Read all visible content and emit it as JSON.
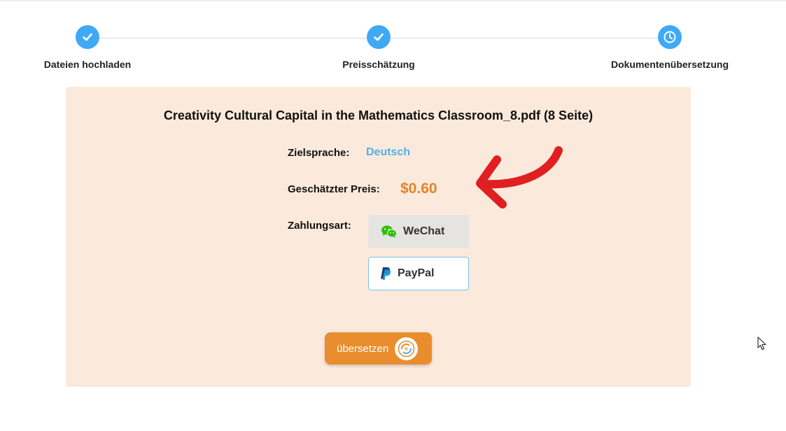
{
  "steps": [
    {
      "label": "Dateien hochladen",
      "status": "done",
      "icon": "check-icon"
    },
    {
      "label": "Preisschätzung",
      "status": "done",
      "icon": "check-icon"
    },
    {
      "label": "Dokumentenübersetzung",
      "status": "current",
      "icon": "clock-icon"
    }
  ],
  "card": {
    "file_title": "Creativity Cultural Capital in the Mathematics Classroom_8.pdf (8 Seite)",
    "target_language_label": "Zielsprache:",
    "target_language_value": "Deutsch",
    "price_label": "Geschätzter Preis:",
    "price_value": "$0.60",
    "payment_label": "Zahlungsart:",
    "payment_options": [
      {
        "label": "WeChat",
        "icon": "wechat-icon",
        "selected": true
      },
      {
        "label": "PayPal",
        "icon": "paypal-icon",
        "selected": false
      }
    ],
    "translate_button": "übersetzen",
    "translate_icon": "translate-swirl-icon"
  },
  "colors": {
    "step_blue": "#3fa9f5",
    "card_bg": "#fbeadc",
    "language_blue": "#54b0e8",
    "price_orange": "#e0852d",
    "button_orange": "#e98d2e",
    "annotation_red": "#e02020"
  },
  "annotations": {
    "arrow": "red-arrow-pointing-to-price"
  }
}
